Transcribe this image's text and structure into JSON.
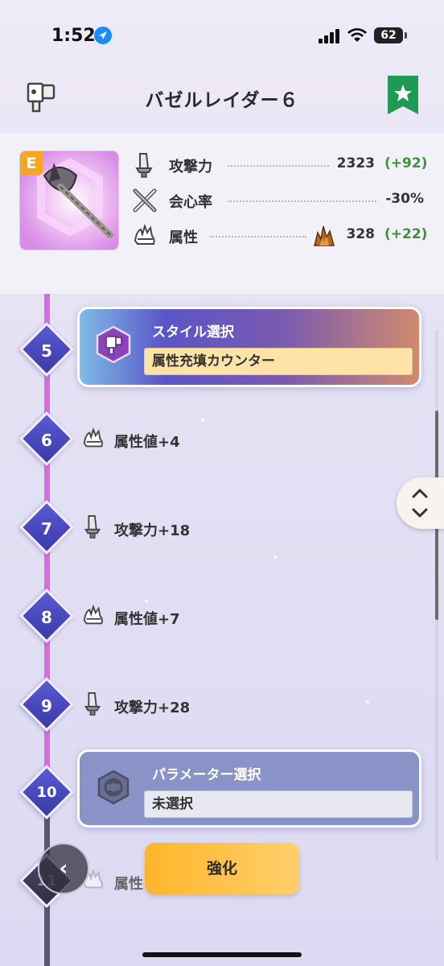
{
  "status_bar": {
    "time": "1:52",
    "battery": "62"
  },
  "header": {
    "title": "バゼルレイダー６"
  },
  "weapon": {
    "rank": "E",
    "stats": [
      {
        "label": "攻撃力",
        "value": "2323",
        "bonus": "(+92)",
        "icon": "sword-icon"
      },
      {
        "label": "会心率",
        "value": "-30%",
        "bonus": "",
        "icon": "crossed-swords-icon"
      },
      {
        "label": "属性",
        "value": "328",
        "bonus": "(+22)",
        "icon": "element-claw-icon"
      }
    ]
  },
  "timeline": [
    {
      "level": "5",
      "type": "card",
      "title": "スタイル選択",
      "value": "属性充填カウンター"
    },
    {
      "level": "6",
      "type": "step",
      "text": "属性値+4",
      "icon": "element-claw-icon"
    },
    {
      "level": "7",
      "type": "step",
      "text": "攻撃力+18",
      "icon": "sword-icon"
    },
    {
      "level": "8",
      "type": "step",
      "text": "属性値+7",
      "icon": "element-claw-icon"
    },
    {
      "level": "9",
      "type": "step",
      "text": "攻撃力+28",
      "icon": "sword-icon"
    },
    {
      "level": "10",
      "type": "card",
      "title": "パラメーター選択",
      "value": "未選択"
    },
    {
      "level": "11",
      "type": "step",
      "text": "属性",
      "icon": "element-claw-icon"
    }
  ],
  "buttons": {
    "back": "‹",
    "enhance": "強化"
  },
  "colors": {
    "accent": "#5a5ad4",
    "timeline_line": "#d66de0",
    "enhance_button": "#ffb52b",
    "bonus_green": "#3f8f3f",
    "favorite_green": "#1e9a52"
  }
}
